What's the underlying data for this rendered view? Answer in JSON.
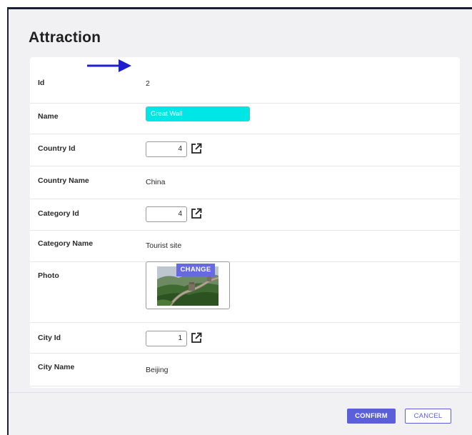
{
  "page": {
    "title": "Attraction"
  },
  "fields": {
    "id": {
      "label": "Id",
      "value": "2"
    },
    "name": {
      "label": "Name",
      "value": "Great Wall"
    },
    "country_id": {
      "label": "Country Id",
      "value": "4"
    },
    "country_name": {
      "label": "Country Name",
      "value": "China"
    },
    "category_id": {
      "label": "Category Id",
      "value": "4"
    },
    "category_name": {
      "label": "Category Name",
      "value": "Tourist site"
    },
    "photo": {
      "label": "Photo",
      "change_label": "CHANGE"
    },
    "city_id": {
      "label": "City Id",
      "value": "1"
    },
    "city_name": {
      "label": "City Name",
      "value": "Beijing"
    }
  },
  "footer": {
    "confirm_label": "CONFIRM",
    "cancel_label": "CANCEL"
  },
  "colors": {
    "accent": "#5b5fd8",
    "name_highlight": "#00e6e6",
    "arrow": "#1f1fd0",
    "frame": "#1c1f33"
  },
  "icons": {
    "edit": "external-link-edit-icon",
    "pointer": "arrow-right-icon"
  }
}
